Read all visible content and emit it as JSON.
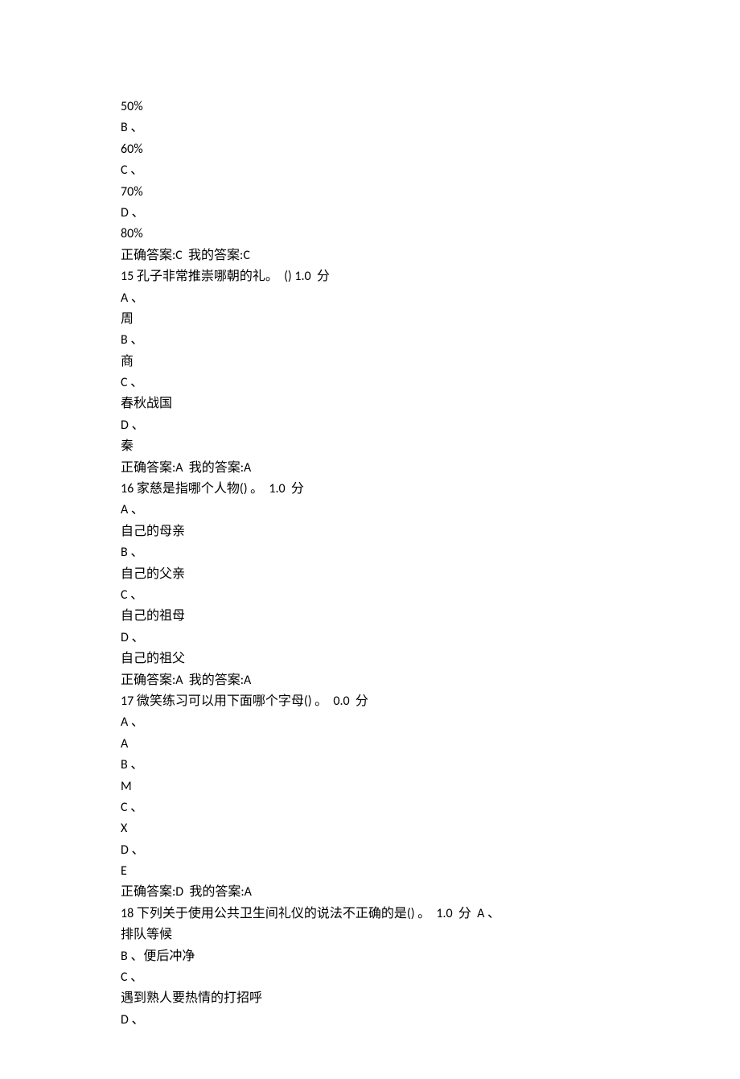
{
  "lines": [
    "50%",
    "B 、",
    "60%",
    "C 、",
    "70%",
    "D 、",
    "80%",
    "正确答案:C  我的答案:C",
    "15 孔子非常推崇哪朝的礼。  () 1.0  分",
    "A 、",
    "周",
    "B 、",
    "商",
    "C 、",
    "春秋战国",
    "D 、",
    "秦",
    "正确答案:A  我的答案:A",
    "16 家慈是指哪个人物() 。  1.0  分",
    "A 、",
    "自己的母亲",
    "B 、",
    "自己的父亲",
    "C 、",
    "自己的祖母",
    "D 、",
    "自己的祖父",
    "正确答案:A  我的答案:A",
    "17 微笑练习可以用下面哪个字母() 。  0.0  分",
    "A 、",
    "A",
    "B 、",
    "M",
    "C 、",
    "X",
    "D 、",
    "E",
    "正确答案:D  我的答案:A",
    "18 下列关于使用公共卫生间礼仪的说法不正确的是() 。  1.0  分  A 、",
    "排队等候",
    "B 、便后冲净",
    "C 、",
    "遇到熟人要热情的打招呼",
    "D 、"
  ]
}
